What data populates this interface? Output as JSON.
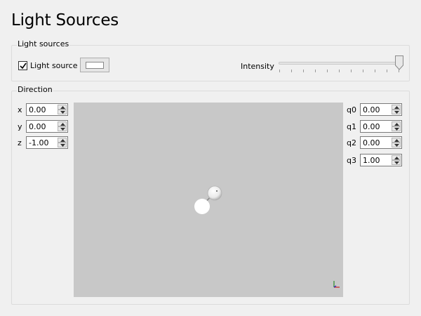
{
  "page": {
    "title": "Light Sources"
  },
  "light_sources_group": {
    "label": "Light sources",
    "checkbox": {
      "label": "Light source",
      "checked": true
    },
    "color_button": {
      "color": "#ffffff"
    },
    "intensity": {
      "label": "Intensity",
      "value_fraction": 1.0
    }
  },
  "direction_group": {
    "label": "Direction",
    "vector": [
      {
        "label": "x",
        "value": "0.00"
      },
      {
        "label": "y",
        "value": "0.00"
      },
      {
        "label": "z",
        "value": "-1.00"
      }
    ],
    "quaternion": [
      {
        "label": "q0",
        "value": "0.00"
      },
      {
        "label": "q1",
        "value": "0.00"
      },
      {
        "label": "q2",
        "value": "0.00"
      },
      {
        "label": "q3",
        "value": "1.00"
      }
    ],
    "viewport": {
      "background": "#c8c8c8"
    }
  }
}
